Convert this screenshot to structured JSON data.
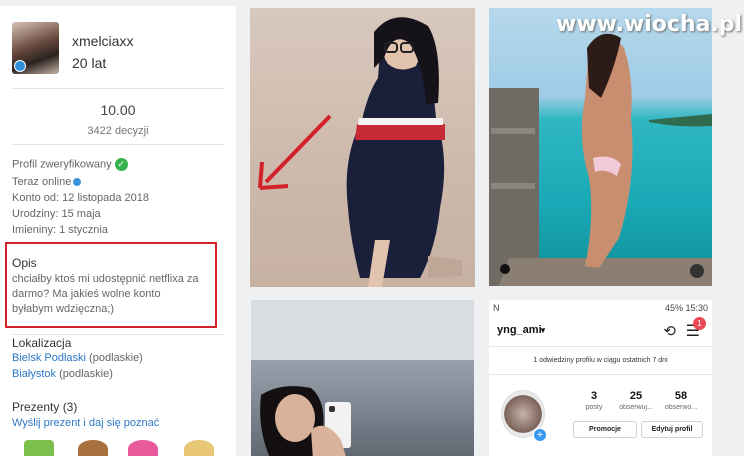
{
  "profile": {
    "username": "xmelciaxx",
    "age": "20 lat",
    "score": "10.00",
    "decisions": "3422 decyzji",
    "verified": "Profil zweryfikowany",
    "online": "Teraz online",
    "account_since": "Konto od: 12 listopada 2018",
    "birthday": "Urodziny: 15 maja",
    "nameday": "Imieniny: 1 stycznia",
    "opis_title": "Opis",
    "opis_text": "chciałby ktoś mi udostępnić netflixa za darmo? Ma jakieś wolne konto byłabym wdzięczna;)",
    "location_title": "Lokalizacja",
    "locations": [
      {
        "city": "Bielsk Podlaski",
        "region": "(podlaskie)"
      },
      {
        "city": "Białystok",
        "region": "(podlaskie)"
      }
    ],
    "gifts_title": "Prezenty (3)",
    "gift_link": "Wyślij prezent i daj się poznać"
  },
  "watermark": "www.wiocha.pl",
  "instagram": {
    "status_left": "N",
    "status_right": "45% 15:30",
    "username": "yng_ami",
    "notif_count": "1",
    "visits": "1 odwiedziny profilu w ciągu ostatnich 7 dni",
    "stats": [
      {
        "num": "3",
        "label": "posty"
      },
      {
        "num": "25",
        "label": "obserwuj..."
      },
      {
        "num": "58",
        "label": "obserwo..."
      }
    ],
    "promo_label": "Promocje",
    "edit_label": "Edytuj profil"
  },
  "colors": {
    "highlight": "#d4202b",
    "link": "#2d78c4",
    "verified": "#37b24d"
  }
}
